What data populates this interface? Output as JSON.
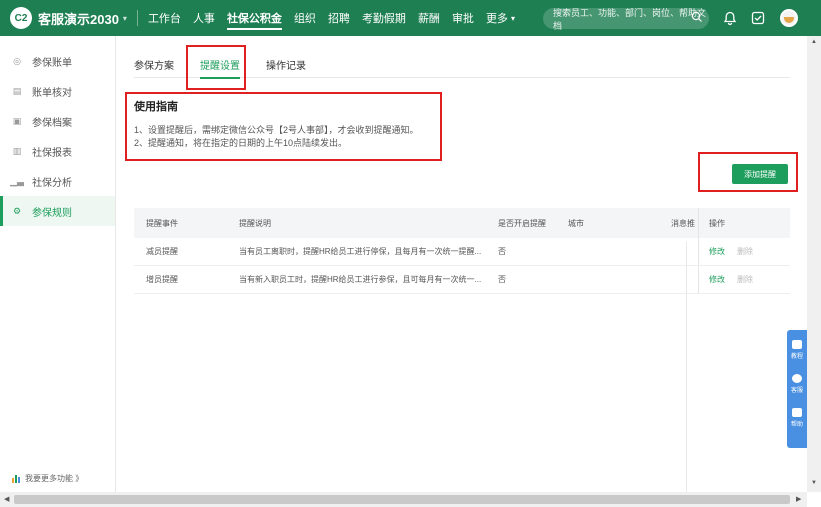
{
  "header": {
    "logo_text": "C2",
    "company": "客服演示2030",
    "nav": [
      {
        "label": "工作台"
      },
      {
        "label": "人事"
      },
      {
        "label": "社保公积金"
      },
      {
        "label": "组织"
      },
      {
        "label": "招聘"
      },
      {
        "label": "考勤假期"
      },
      {
        "label": "薪酬"
      },
      {
        "label": "审批"
      },
      {
        "label": "更多"
      }
    ],
    "active_nav": "社保公积金",
    "search_placeholder": "搜索员工、功能、部门、岗位、帮助文档"
  },
  "sidebar": {
    "items": [
      {
        "label": "参保账单",
        "icon": "bill-icon"
      },
      {
        "label": "账单核对",
        "icon": "check-icon"
      },
      {
        "label": "参保档案",
        "icon": "archive-icon"
      },
      {
        "label": "社保报表",
        "icon": "report-icon"
      },
      {
        "label": "社保分析",
        "icon": "chart-icon"
      },
      {
        "label": "参保规则",
        "icon": "gear-icon"
      }
    ],
    "active": "参保规则",
    "more_label": "我要更多功能 》"
  },
  "tabs": [
    {
      "label": "参保方案"
    },
    {
      "label": "提醒设置"
    },
    {
      "label": "操作记录"
    }
  ],
  "active_tab": "提醒设置",
  "guide": {
    "title": "使用指南",
    "line1": "1、设置提醒后，需绑定微信公众号【2号人事部】，才会收到提醒通知。",
    "line2": "2、提醒通知，将在指定的日期的上午10点陆续发出。"
  },
  "add_button": "添加提醒",
  "table": {
    "headers": [
      "提醒事件",
      "提醒说明",
      "是否开启提醒",
      "城市",
      "消息推",
      "操作"
    ],
    "rows": [
      {
        "event": "减员提醒",
        "desc": "当有员工离职时，提醒HR给员工进行停保，且每月有一次统一提醒...",
        "enabled": "否",
        "city": "",
        "msg": "",
        "edit": "修改",
        "delete": "删除"
      },
      {
        "event": "增员提醒",
        "desc": "当有新入职员工时，提醒HR给员工进行参保，且可每月有一次统一...",
        "enabled": "否",
        "city": "",
        "msg": "",
        "edit": "修改",
        "delete": "删除"
      }
    ]
  },
  "float_help": [
    {
      "label": "教程",
      "icon": "tutorial-icon"
    },
    {
      "label": "客服",
      "icon": "chat-icon"
    },
    {
      "label": "帮助",
      "icon": "doc-icon"
    }
  ],
  "colors": {
    "topbar": "#1e7f53",
    "accent": "#1e9e5c",
    "highlight_box": "#e02020",
    "float_panel": "#4a90e2"
  }
}
